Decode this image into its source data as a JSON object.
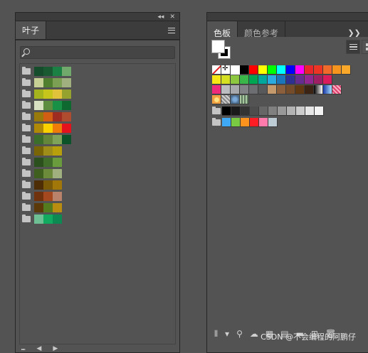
{
  "left_panel": {
    "tab": "叶子",
    "topbar_icons": [
      "collapse-icon",
      "close-icon"
    ],
    "search": {
      "placeholder": ""
    },
    "groups": [
      [
        "#154c2c",
        "#195a32",
        "#1a8044",
        "#71a86c"
      ],
      [
        "#c7d095",
        "#4f7f2f",
        "#7ba053",
        "#a1b07f"
      ],
      [
        "#a4b41d",
        "#c6c51b",
        "#e0c23b",
        "#95a22d"
      ],
      [
        "#d7e1c2",
        "#5d8d3e",
        "#189045",
        "#0d6930"
      ],
      [
        "#977a0b",
        "#d25e13",
        "#9f2c21",
        "#af4b2f"
      ],
      [
        "#b08a06",
        "#f9d100",
        "#ef7b09",
        "#e3121d"
      ],
      [
        "#3b6e2a",
        "#64863a",
        "#7fa359",
        "#0d5329"
      ],
      [
        "#796505",
        "#9f8d19",
        "#b7a00b"
      ],
      [
        "#2c4f1e",
        "#416d2a",
        "#6a9b3d"
      ],
      [
        "#3e5f1d",
        "#6c8b3b",
        "#a0b07e"
      ],
      [
        "#4c2d05",
        "#7a5a06",
        "#a2770a"
      ],
      [
        "#6f320c",
        "#a3481f",
        "#b9826a"
      ],
      [
        "#5b3909",
        "#557b1f",
        "#b98e10"
      ],
      [
        "#6ec094",
        "#12aa5e",
        "#0c8a52"
      ]
    ]
  },
  "right_panel": {
    "tabs": [
      "色板",
      "颜色参考"
    ],
    "active_tab": 0,
    "tab_icons": [
      "double-chevron-icon",
      "menu-icon"
    ],
    "swatch_rows": [
      [
        "none",
        "registration",
        "#ffffff",
        "#000000",
        "#ff0000",
        "#ffff00",
        "#00ff00",
        "#00ffff",
        "#0000ff",
        "#ff00ff",
        "#e8262c",
        "#ee3424",
        "#f26a2a",
        "#f7941d",
        "#f9a82a"
      ],
      [
        "#f7e715",
        "#d4e021",
        "#8dc63f",
        "#39b54a",
        "#00a651",
        "#00a79d",
        "#29aae1",
        "#1b75bb",
        "#2e3192",
        "#662d91",
        "#92278f",
        "#9e1f63",
        "#da1c5c"
      ],
      [
        "#ee2a7b",
        "#bbbdc0",
        "#a7a9ac",
        "#808285",
        "#6d6e71",
        "#58595b",
        "#c49a6c",
        "#8b5e3c",
        "#754c29",
        "#603913",
        "#3c2415",
        "gradient-bw",
        "gradient-blue",
        "gradient-pink"
      ],
      [
        "orange-circle",
        "pattern-1",
        "pattern-2",
        "pattern-3"
      ]
    ],
    "gray_group": [
      "#000000",
      "#1a1a1a",
      "#333333",
      "#4d4d4d",
      "#666666",
      "#808080",
      "#999999",
      "#b3b3b3",
      "#cccccc",
      "#e6e6e6",
      "#f2f2f2"
    ],
    "color_group": [
      "#3fa9f5",
      "#7ac943",
      "#ff931e",
      "#ff1d25",
      "#ff7bac",
      "#bdccd4"
    ],
    "bottom_toolbar": [
      "swatch-library-icon",
      "show-kinds-icon",
      "swatch-options-icon",
      "cloud-icon",
      "grid-swatch-icon",
      "edit-icon",
      "folder-new-icon",
      "new-swatch-icon",
      "trash-icon"
    ]
  },
  "watermark": "CSDN @不会编程的阿鹏仔"
}
